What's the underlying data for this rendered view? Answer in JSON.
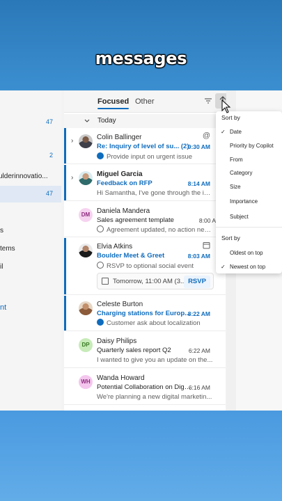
{
  "caption": "messages",
  "sidebar": {
    "items": [
      {
        "label": "",
        "count": "47"
      },
      {
        "label": "",
        "count": "2"
      },
      {
        "label": "ulderinnovatio...",
        "count": ""
      },
      {
        "label": "",
        "count": "47"
      },
      {
        "label": "s",
        "count": ""
      },
      {
        "label": "tems",
        "count": ""
      },
      {
        "label": "il",
        "count": ""
      },
      {
        "label": "nt",
        "count": ""
      }
    ]
  },
  "tabs": {
    "focused": "Focused",
    "other": "Other"
  },
  "day_group": "Today",
  "messages": [
    {
      "sender": "Colin Ballinger",
      "subject": "Re: Inquiry of level of su... (2)",
      "time": "9:30 AM",
      "preview": "Provide input on urgent issue",
      "at_icon": "@"
    },
    {
      "sender": "Miguel Garcia",
      "subject": "Feedback on RFP",
      "time": "8:14 AM",
      "preview": "Hi Samantha, I've gone through the ini..."
    },
    {
      "sender": "Daniela Mandera",
      "initials": "DM",
      "subject": "Sales agreement template",
      "time": "8:00 A",
      "preview": "Agreement updated, no action needed"
    },
    {
      "sender": "Elvia Atkins",
      "subject": "Boulder Meet & Greet",
      "time": "8:03 AM",
      "preview": "RSVP to optional social event",
      "event_time": "Tomorrow, 11:00 AM (3...",
      "rsvp": "RSVP"
    },
    {
      "sender": "Celeste Burton",
      "subject": "Charging stations for Europ...",
      "time": "8:22 AM",
      "preview": "Customer ask about localization"
    },
    {
      "sender": "Daisy Philips",
      "initials": "DP",
      "subject": "Quarterly sales report Q2",
      "time": "6:22 AM",
      "preview": "I wanted to give you an update on the..."
    },
    {
      "sender": "Wanda Howard",
      "initials": "WH",
      "subject": "Potential Collaboration on Digit...",
      "time": "6:16 AM",
      "preview": "We're planning a new digital marketin..."
    }
  ],
  "sort_menu": {
    "sort_by_title": "Sort by",
    "options": [
      "Date",
      "Priority by Copilot",
      "From",
      "Category",
      "Size",
      "Importance",
      "Subject"
    ],
    "selected_option": "Date",
    "order_title": "Sort by",
    "orders": [
      "Oldest on top",
      "Newest on top"
    ],
    "selected_order": "Newest on top"
  },
  "colors": {
    "accent": "#0f6cbd",
    "band_top": "#2b78b8",
    "band_bottom": "#4a9ae0"
  }
}
